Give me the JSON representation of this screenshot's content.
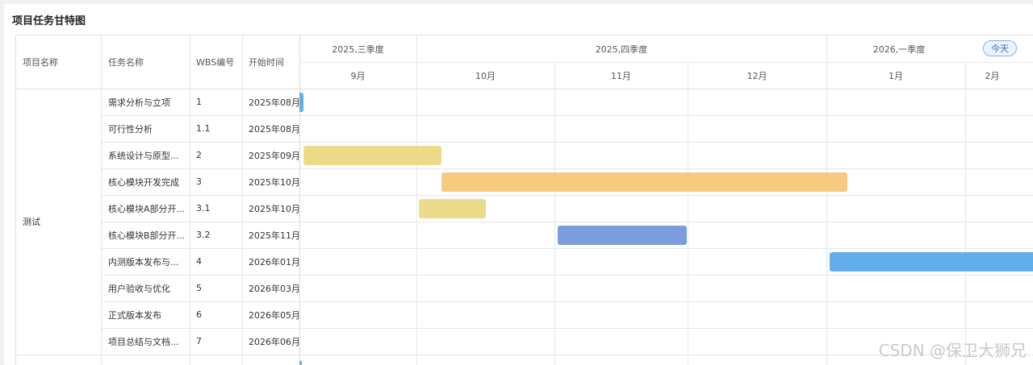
{
  "title": "项目任务甘特图",
  "table": {
    "headers": [
      "项目名称",
      "任务名称",
      "WBS编号",
      "开始时间"
    ],
    "project": "测试",
    "rows": [
      {
        "task": "需求分析与立项",
        "wbs": "1",
        "start": "2025年08月"
      },
      {
        "task": "可行性分析",
        "wbs": "1.1",
        "start": "2025年08月"
      },
      {
        "task": "系统设计与原型...",
        "wbs": "2",
        "start": "2025年09月"
      },
      {
        "task": "核心模块开发完成",
        "wbs": "3",
        "start": "2025年10月"
      },
      {
        "task": "核心模块A部分开...",
        "wbs": "3.1",
        "start": "2025年10月"
      },
      {
        "task": "核心模块B部分开...",
        "wbs": "3.2",
        "start": "2025年11月"
      },
      {
        "task": "内测版本发布与...",
        "wbs": "4",
        "start": "2026年01月"
      },
      {
        "task": "用户验收与优化",
        "wbs": "5",
        "start": "2026年03月"
      },
      {
        "task": "正式版本发布",
        "wbs": "6",
        "start": "2026年05月"
      },
      {
        "task": "项目总结与文档...",
        "wbs": "7",
        "start": "2026年06月"
      }
    ]
  },
  "timeline": {
    "quarters": [
      "2025,三季度",
      "2025,四季度",
      "2026,一季度"
    ],
    "months": [
      "9月",
      "10月",
      "11月",
      "12月",
      "1月",
      "2月"
    ],
    "today_label": "今天"
  },
  "bar_colors": {
    "blue": "#62aeea",
    "yellow": "#ecdc8a",
    "orange": "#f6cb80",
    "indigo": "#7b9de0"
  },
  "watermark": "CSDN @保卫大狮兄"
}
